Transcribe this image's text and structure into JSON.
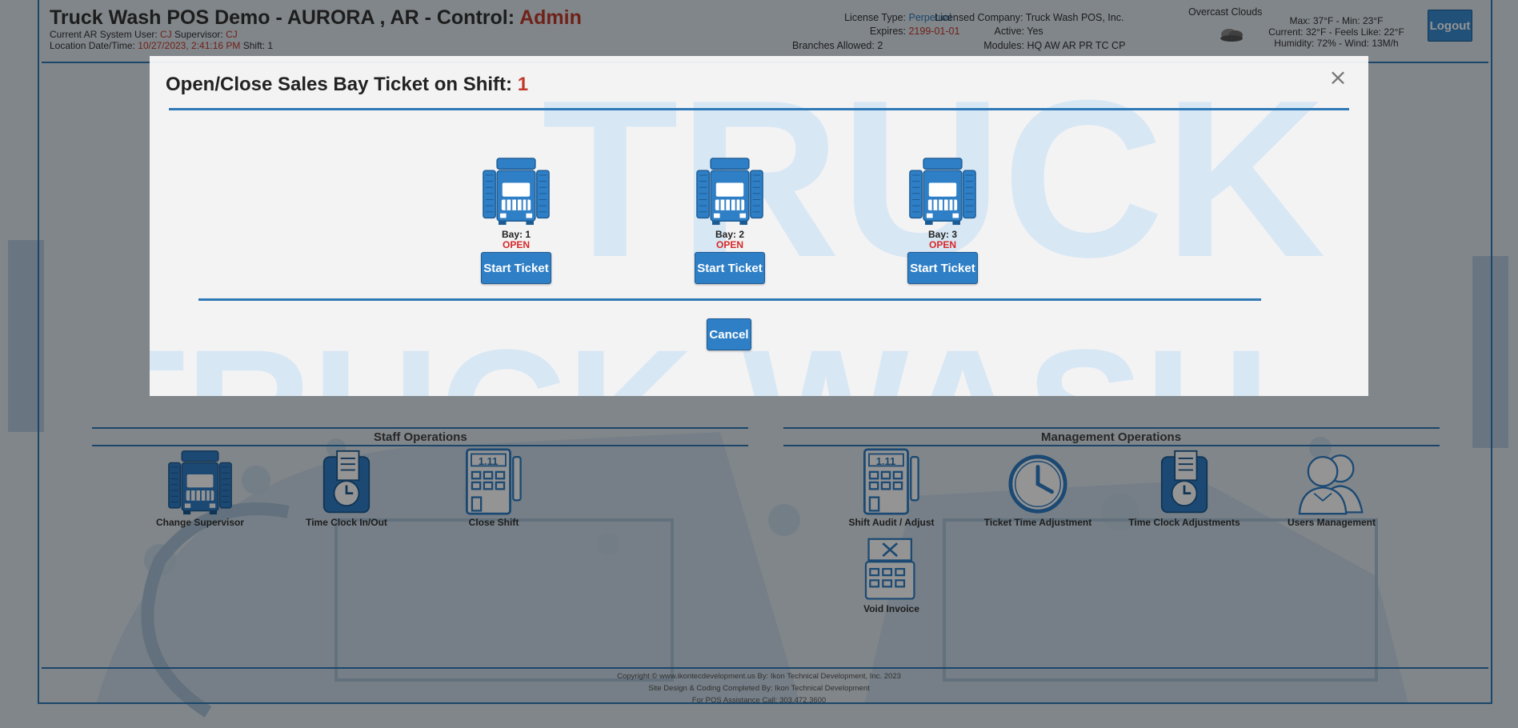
{
  "header": {
    "app_title": "Truck Wash POS Demo - AURORA , AR - Control: ",
    "role": "Admin",
    "current_user_label": "Current AR System User: ",
    "current_user": "CJ",
    "supervisor_label": " Supervisor: ",
    "supervisor": "CJ",
    "datetime_label": "Location Date/Time: ",
    "datetime": "10/27/2023, 2:41:16 PM",
    "shift_label": " Shift: 1"
  },
  "license": {
    "type_label": "License Type:",
    "type": "Perpetual",
    "expires_label": "Expires:",
    "expires": "2199-01-01",
    "branches_label": "Branches Allowed:",
    "branches": "2",
    "company_label": "Licensed Company:",
    "company": "Truck Wash POS, Inc.",
    "active_label": "Active:",
    "active": "Yes",
    "modules_label": "Modules:",
    "modules": "HQ AW AR PR TC CP"
  },
  "weather": {
    "description": "Overcast Clouds",
    "icon": "cloud-icon",
    "maxmin": "Max: 37°F - Min: 23°F",
    "current": "Current: 32°F - Feels Like: 22°F",
    "humidity": "Humidity: 72% - Wind: 13M/h"
  },
  "logout_label": "Logout",
  "staff_operations": {
    "title": "Staff Operations",
    "items": [
      {
        "label": "Change Supervisor",
        "icon": "truck-wash-icon"
      },
      {
        "label": "Time Clock In/Out",
        "icon": "time-clock-icon"
      },
      {
        "label": "Close Shift",
        "icon": "cash-register-icon"
      }
    ]
  },
  "management_operations": {
    "title": "Management Operations",
    "items": [
      {
        "label": "Shift Audit / Adjust",
        "icon": "cash-register-icon"
      },
      {
        "label": "Ticket Time Adjustment",
        "icon": "clock-icon"
      },
      {
        "label": "Time Clock Adjustments",
        "icon": "time-clock-icon"
      },
      {
        "label": "Users Management",
        "icon": "users-icon"
      },
      {
        "label": "Void Invoice",
        "icon": "void-invoice-icon"
      }
    ]
  },
  "register_digits": "1.11",
  "footer": {
    "line1": "Copyright © www.ikontecdevelopment.us By: Ikon Technical Development, Inc. 2023",
    "line2": "Site Design & Coding Completed By: Ikon Technical Development",
    "line3": "For POS Assistance Call: 303.472.3600"
  },
  "watermark": {
    "top": "TRUCK",
    "bottom": "TRUCK WASH"
  },
  "modal": {
    "title": "Open/Close Sales Bay Ticket on Shift: ",
    "shift": "1",
    "close_symbol": "×",
    "bays": [
      {
        "name": "Bay: 1",
        "status": "OPEN",
        "button": "Start Ticket"
      },
      {
        "name": "Bay: 2",
        "status": "OPEN",
        "button": "Start Ticket"
      },
      {
        "name": "Bay: 3",
        "status": "OPEN",
        "button": "Start Ticket"
      }
    ],
    "cancel_label": "Cancel"
  }
}
